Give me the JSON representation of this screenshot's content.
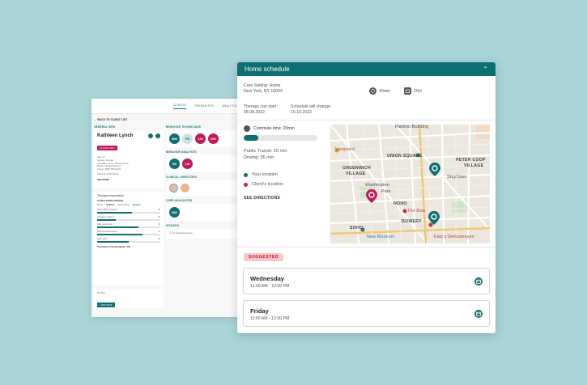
{
  "back_window": {
    "tabs": [
      "CLIENTS",
      "THERAPISTS",
      "ANALYTICS"
    ],
    "back_link": "BACK TO CLIENT LIST",
    "general_info": {
      "section_title": "GENERAL INFO",
      "client_name": "Kathleen Lynch",
      "badge": "IN LOAD TEXT",
      "lines": [
        "Age: 12",
        "Gender: Female",
        "Caretaker name: Victoria Smith",
        "Email: care@email.com",
        "Phone: (555) 555-0123",
        "Address: 1234 Street"
      ],
      "see_more": "SEE MORE"
    },
    "therapy": {
      "title": "Therapy expectation",
      "subtitle": "CLIENT EXPECTATIONS",
      "filters": [
        "Direct",
        "Indirect",
        "Supervision",
        "Review"
      ],
      "bars": [
        {
          "label": "Direct ABA Treatment",
          "value": "4h",
          "fraction": 0.55
        },
        {
          "label": "Caregiver training",
          "value": "2h",
          "fraction": 0.3
        },
        {
          "label": "ABA supervision",
          "value": "6h",
          "fraction": 0.65
        },
        {
          "label": "Reduced Supervision",
          "value": "7h",
          "fraction": 0.72
        },
        {
          "label": "Staff notes",
          "value": "4h",
          "fraction": 0.5
        }
      ],
      "total": "Total Direct Therapy/Week: 20h"
    },
    "notes": {
      "title": "NOTES",
      "add_note": "ADD NOTE"
    },
    "behavior_technicians": {
      "title": "BEHAVIOR TECHNICIANS",
      "avatars": [
        "BW",
        "PN",
        "LM",
        "KM"
      ]
    },
    "behavior_analysts": {
      "title": "BEHAVIOR ANALYSTS",
      "avatars": [
        "SD",
        "LM"
      ]
    },
    "clinical_directors": {
      "title": "CLINICAL DIRECTORS"
    },
    "care_advocates": {
      "title": "CARE ADVOCATES",
      "avatars": [
        "BW"
      ]
    },
    "referral": {
      "title": "INTAKE/S",
      "text": "No intake/start team"
    }
  },
  "home_schedule": {
    "title": "Home schedule",
    "care_setting_label": "Care Setting: Home",
    "care_setting_address": "New York, NY 10003",
    "chip_duration": "40min",
    "chip_frequency": "15hi",
    "therapy_start_label": "Therapy can start:",
    "therapy_start_date": "08.08.2022",
    "schedule_change_label": "Schedule will change:",
    "schedule_change_date": "10.10.2022",
    "commute_label": "Commute time: 20min",
    "commute_progress": 0.2,
    "public_transit": "Public Transit: 20 min",
    "driving": "Driving: 35 min",
    "legend_your": "Your location",
    "legend_client": "Client's location",
    "see_directions": "SEE DIRECTIONS",
    "suggested": "SUGGESTED",
    "slots": [
      {
        "day": "Wednesday",
        "time": "11:00 AM - 12:00 PM"
      },
      {
        "day": "Friday",
        "time": "11:00 AM - 12:00 PM"
      }
    ],
    "map_labels": {
      "flatiron": "Flatiron Building",
      "vanguard": "Vanguard",
      "union_square": "UNION SQUARE",
      "greenwich1": "GREENWICH",
      "greenwich2": "VILLAGE",
      "peter1": "PETER COOP",
      "peter2": "VILLAGE",
      "washington1": "Washington",
      "washington2": "Park",
      "noho": "NOHO",
      "stuytown": "StuyTown",
      "bowery_bar": "The Bow",
      "bowery": "BOWERY",
      "soho": "SOHO",
      "new_museum": "New Museum",
      "katz": "Katz's Delicatessen"
    },
    "colors": {
      "teal": "#0e6f72",
      "pink": "#c2185b"
    }
  }
}
